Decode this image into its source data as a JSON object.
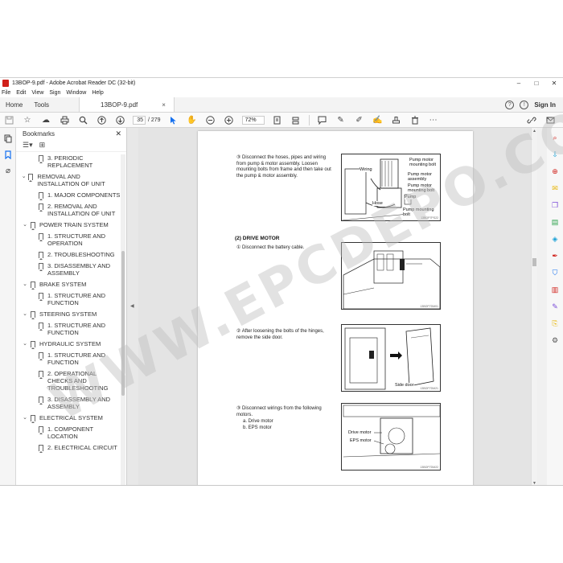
{
  "window": {
    "title": "13BOP-9.pdf - Adobe Acrobat Reader DC (32-bit)"
  },
  "window_controls": {
    "minimize": "–",
    "maximize": "□",
    "close": "✕"
  },
  "menu": [
    "File",
    "Edit",
    "View",
    "Sign",
    "Window",
    "Help"
  ],
  "tabs": {
    "home": "Home",
    "tools": "Tools",
    "document": "13BOP-9.pdf",
    "close": "×",
    "sign_in": "Sign In"
  },
  "toolbar": {
    "page_current": "35",
    "page_total": "/ 279",
    "zoom": "72%"
  },
  "bookmarks": {
    "title": "Bookmarks",
    "items": [
      {
        "level": 2,
        "label": "3. PERIODIC REPLACEMENT"
      },
      {
        "level": 1,
        "label": "REMOVAL AND INSTALLATION OF UNIT"
      },
      {
        "level": 2,
        "label": "1. MAJOR COMPONENTS"
      },
      {
        "level": 2,
        "label": "2. REMOVAL AND INSTALLATION OF UNIT"
      },
      {
        "level": 1,
        "label": "POWER TRAIN SYSTEM"
      },
      {
        "level": 2,
        "label": "1. STRUCTURE AND OPERATION"
      },
      {
        "level": 2,
        "label": "2. TROUBLESHOOTING"
      },
      {
        "level": 2,
        "label": "3. DISASSEMBLY AND ASSEMBLY"
      },
      {
        "level": 1,
        "label": "BRAKE SYSTEM"
      },
      {
        "level": 2,
        "label": "1. STRUCTURE AND FUNCTION"
      },
      {
        "level": 1,
        "label": "STEERING SYSTEM"
      },
      {
        "level": 2,
        "label": "1. STRUCTURE AND FUNCTION"
      },
      {
        "level": 1,
        "label": "HYDRAULIC SYSTEM"
      },
      {
        "level": 2,
        "label": "1. STRUCTURE AND FUNCTION"
      },
      {
        "level": 2,
        "label": "2. OPERATIONAL CHECKS AND TROUBLESHOOTING"
      },
      {
        "level": 2,
        "label": "3. DISASSEMBLY AND ASSEMBLY"
      },
      {
        "level": 1,
        "label": "ELECTRICAL SYSTEM"
      },
      {
        "level": 2,
        "label": "1. COMPONENT LOCATION"
      },
      {
        "level": 2,
        "label": "2. ELECTRICAL CIRCUIT"
      }
    ]
  },
  "document": {
    "step1": "③ Disconnect the hoses, pipes and wiring from pump & motor assembly. Loosen mounting bolts from frame and then take out the pump & motor assembly.",
    "fig1": {
      "wiring": "Wiring",
      "pump_motor_bolt": "Pump motor mounting bolt",
      "pump_motor_assembly": "Pump motor assembly",
      "pump_motor_bolt2": "Pump motor mounting bolt",
      "pump": "Pump",
      "hose": "Hose",
      "pump_mounting_bolt": "Pump mounting bolt"
    },
    "section": "(2) DRIVE MOTOR",
    "step2": "① Disconnect the battery cable.",
    "step3": "② After loosening the bolts of the hinges, remove the side door.",
    "fig3": {
      "side_door": "Side door"
    },
    "step4_a": "③ Disconnect wirings from the following motors.",
    "step4_b": "a. Drive motor",
    "step4_c": "b. EPS motor",
    "fig4": {
      "drive_motor": "Drive motor",
      "eps_motor": "EPS motor"
    }
  },
  "watermark": "WWW.EPCDEPO.COM"
}
